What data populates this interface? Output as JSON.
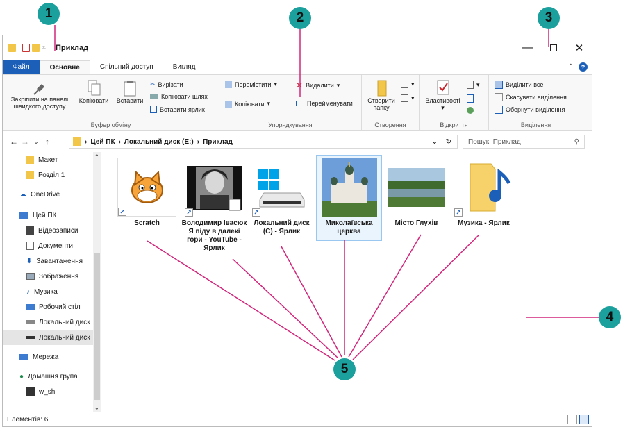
{
  "window": {
    "title": "Приклад"
  },
  "tabs": [
    "Файл",
    "Основне",
    "Спільний доступ",
    "Вигляд"
  ],
  "ribbon": {
    "clipboard": {
      "pin": "Закріпити на панелі швидкого доступу",
      "copy": "Копіювати",
      "paste": "Вставити",
      "cut": "Вирізати",
      "copy_path": "Копіювати шлях",
      "paste_shortcut": "Вставити ярлик",
      "label": "Буфер обміну"
    },
    "organize": {
      "move": "Перемістити",
      "copy_to": "Копіювати",
      "delete": "Видалити",
      "rename": "Перейменувати",
      "label": "Упорядкування"
    },
    "new": {
      "new_folder": "Створити папку",
      "label": "Створення"
    },
    "open": {
      "properties": "Властивості",
      "label": "Відкриття"
    },
    "select": {
      "select_all": "Виділити все",
      "select_none": "Скасувати виділення",
      "invert": "Обернути виділення",
      "label": "Виділення"
    }
  },
  "address": {
    "crumbs": [
      "Цей ПК",
      "Локальний диск (E:)",
      "Приклад"
    ],
    "search_placeholder": "Пошук: Приклад"
  },
  "nav": [
    {
      "label": "Макет",
      "icon": "folder-icon"
    },
    {
      "label": "Розділ 1",
      "icon": "folder-icon"
    },
    {
      "label": "OneDrive",
      "icon": "cloud-icon"
    },
    {
      "label": "Цей ПК",
      "icon": "computer-icon"
    },
    {
      "label": "Відеозаписи",
      "icon": "video-icon"
    },
    {
      "label": "Документи",
      "icon": "document-icon"
    },
    {
      "label": "Завантаження",
      "icon": "download-icon"
    },
    {
      "label": "Зображення",
      "icon": "picture-icon"
    },
    {
      "label": "Музика",
      "icon": "music-icon"
    },
    {
      "label": "Робочий стіл",
      "icon": "desktop-icon"
    },
    {
      "label": "Локальний диск",
      "icon": "drive-icon"
    },
    {
      "label": "Локальний диск",
      "icon": "drive-icon"
    },
    {
      "label": "Мережа",
      "icon": "network-icon"
    },
    {
      "label": "Домашня група",
      "icon": "homegroup-icon"
    },
    {
      "label": "w_sh",
      "icon": "user-icon"
    }
  ],
  "files": [
    {
      "name": "Scratch",
      "icon": "scratch-cat-icon",
      "shortcut": true
    },
    {
      "name": "Володимир Івасюк Я піду в далекі гори - YouTube - Ярлик",
      "icon": "video-thumbnail",
      "shortcut": true
    },
    {
      "name": "Локальний диск (C) - Ярлик",
      "icon": "windows-drive-icon",
      "shortcut": true
    },
    {
      "name": "Миколаївська церква",
      "icon": "church-photo",
      "shortcut": false
    },
    {
      "name": "Місто Глухів",
      "icon": "landscape-photo",
      "shortcut": false
    },
    {
      "name": "Музика - Ярлик",
      "icon": "music-folder-icon",
      "shortcut": true
    }
  ],
  "status": {
    "count": "Елементів: 6"
  },
  "callouts": [
    "1",
    "2",
    "3",
    "4",
    "5"
  ],
  "colors": {
    "accent": "#1c5fb8",
    "callout": "#1ba09d",
    "line": "#d1257b"
  }
}
